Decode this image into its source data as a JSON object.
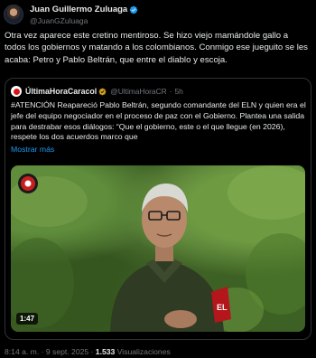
{
  "author": {
    "display_name": "Juan Guillermo Zuluaga",
    "handle": "@JuanGZuluaga",
    "avatar_icon": "user-avatar-icon",
    "verified_color": "#1d9bf0"
  },
  "tweet": {
    "text": "Otra vez aparece este cretino mentiroso. Se hizo viejo mamándole gallo a todos los gobiernos y matando a los colombianos. Conmigo ese jueguito se les acaba: Petro y Pablo Beltrán, que entre el diablo y escoja."
  },
  "quoted": {
    "display_name": "ÚltimaHoraCaracol",
    "handle": "@UltimaHoraCR",
    "dot": "·",
    "time": "5h",
    "text": "#ATENCIÓN Reapareció Pablo Beltrán, segundo comandante del ELN y quien era el jefe del equipo negociador en el proceso de paz con el Gobierno. Plantea una salida para destrabar esos diálogos: “Que el gobierno, este o el que llegue (en 2026), respete los dos acuerdos marco que",
    "show_more": "Mostrar más",
    "video": {
      "duration": "1:47"
    }
  },
  "footer": {
    "timestamp": "8:14 a. m. · 9 sept. 2025 ·",
    "views_count": "1.533",
    "views_label": "Visualizaciones"
  },
  "colors": {
    "background": "#000000",
    "text": "#e7e9ea",
    "muted": "#71767b",
    "link": "#1d9bf0",
    "border": "#2f3336"
  }
}
